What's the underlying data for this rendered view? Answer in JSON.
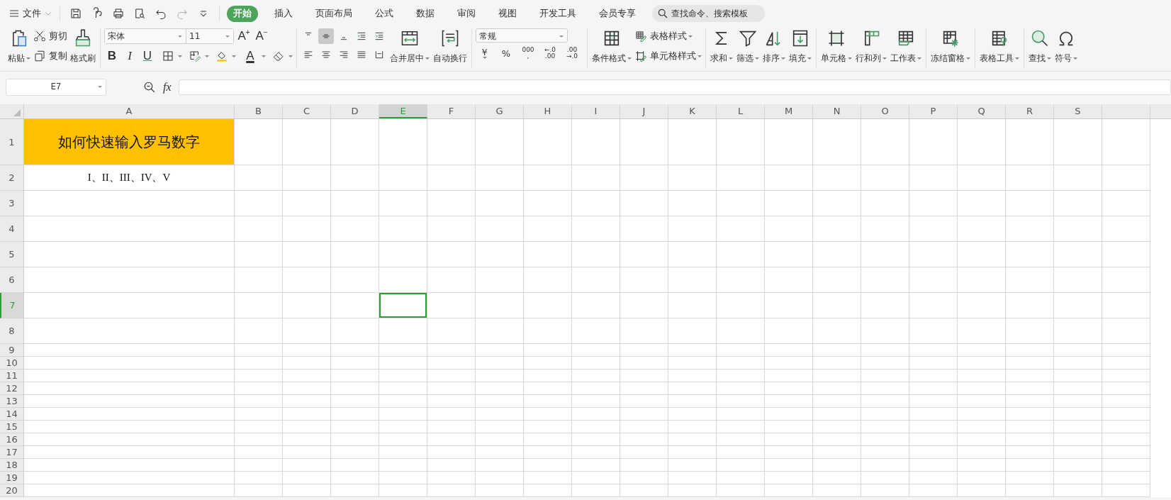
{
  "menu": {
    "label": "文件"
  },
  "quick_access": [
    {
      "disabled": false
    },
    {
      "disabled": false
    },
    {
      "disabled": false
    },
    {
      "disabled": false
    },
    {
      "disabled": false
    },
    {
      "disabled": true
    },
    {
      "disabled": false
    }
  ],
  "tabs": [
    {
      "label": "开始",
      "selected": true
    },
    {
      "label": "插入",
      "selected": false
    },
    {
      "label": "页面布局",
      "selected": false
    },
    {
      "label": "公式",
      "selected": false
    },
    {
      "label": "数据",
      "selected": false
    },
    {
      "label": "审阅",
      "selected": false
    },
    {
      "label": "视图",
      "selected": false
    },
    {
      "label": "开发工具",
      "selected": false
    },
    {
      "label": "会员专享",
      "selected": false
    }
  ],
  "search": {
    "placeholder": "查找命令、搜索模板"
  },
  "clipboard": {
    "paste": {
      "label": "粘贴",
      "dropdown": true
    },
    "small": [
      {
        "label": "剪切",
        "dropdown": false
      },
      {
        "label": "复制",
        "dropdown": false
      }
    ],
    "painter": {
      "label": "格式刷",
      "dropdown": false
    }
  },
  "font": {
    "name": "宋体",
    "size": "11",
    "grow": "A$^{+}$",
    "shrink": "A$^{−}$",
    "styles": [
      {
        "label": "B"
      },
      {
        "label": "I"
      },
      {
        "label": "U"
      }
    ],
    "color_letter": "A"
  },
  "alignment": {
    "buttons": [
      {
        "selected": false
      },
      {
        "selected": true
      },
      {
        "selected": false
      },
      {
        "selected": false
      },
      {
        "selected": false
      },
      {
        "selected": false
      },
      {
        "selected": false
      },
      {
        "selected": false
      },
      {
        "selected": false
      },
      {
        "selected": false
      }
    ],
    "large": [
      {
        "label": "合并居中",
        "dropdown": true
      },
      {
        "label": "自动换行",
        "dropdown": false
      }
    ]
  },
  "number": {
    "format": "常规",
    "buttons": [
      {
        "lines": [
          "￥"
        ],
        "dropdown": true
      },
      {
        "lines": [
          "%"
        ],
        "dropdown": false
      },
      {
        "lines": [
          "000",
          ","
        ],
        "dropdown": false
      },
      {
        "lines": [
          "←.0",
          ".00"
        ],
        "dropdown": false
      },
      {
        "lines": [
          ".00",
          "→.0"
        ],
        "dropdown": false
      }
    ]
  },
  "groups": [
    {
      "large": [
        {
          "label": "条件格式",
          "dropdown": true
        }
      ],
      "small": [
        {
          "label": "表格样式",
          "dropdown": true
        },
        {
          "label": "单元格样式",
          "dropdown": true
        }
      ]
    },
    {
      "large": [
        {
          "label": "求和",
          "dropdown": true
        },
        {
          "label": "筛选",
          "dropdown": true
        },
        {
          "label": "排序",
          "dropdown": true
        },
        {
          "label": "填充",
          "dropdown": true
        }
      ]
    },
    {
      "large": [
        {
          "label": "单元格",
          "dropdown": true
        },
        {
          "label": "行和列",
          "dropdown": true
        },
        {
          "label": "工作表",
          "dropdown": true
        }
      ]
    },
    {
      "large": [
        {
          "label": "冻结窗格",
          "dropdown": true
        }
      ]
    },
    {
      "large": [
        {
          "label": "表格工具",
          "dropdown": true
        }
      ]
    },
    {
      "large": [
        {
          "label": "查找",
          "dropdown": true
        },
        {
          "label": "符号",
          "dropdown": true
        }
      ]
    }
  ],
  "formula_bar": {
    "name_box": "E7",
    "fx": "fx"
  },
  "sheet": {
    "columns": [
      {
        "label": "A",
        "selected": false
      },
      {
        "label": "B",
        "selected": false
      },
      {
        "label": "C",
        "selected": false
      },
      {
        "label": "D",
        "selected": false
      },
      {
        "label": "E",
        "selected": true
      },
      {
        "label": "F",
        "selected": false
      },
      {
        "label": "G",
        "selected": false
      },
      {
        "label": "H",
        "selected": false
      },
      {
        "label": "I",
        "selected": false
      },
      {
        "label": "J",
        "selected": false
      },
      {
        "label": "K",
        "selected": false
      },
      {
        "label": "L",
        "selected": false
      },
      {
        "label": "M",
        "selected": false
      },
      {
        "label": "N",
        "selected": false
      },
      {
        "label": "O",
        "selected": false
      },
      {
        "label": "P",
        "selected": false
      },
      {
        "label": "Q",
        "selected": false
      },
      {
        "label": "R",
        "selected": false
      },
      {
        "label": "S",
        "selected": false
      }
    ],
    "rows": [
      {
        "label": "1",
        "selected": false,
        "cells": [
          {
            "text": "如何快速输入罗马数字",
            "color": "#ffc000"
          }
        ]
      },
      {
        "label": "2",
        "selected": false,
        "cells": [
          {
            "text": "I、II、III、IV、V"
          }
        ]
      },
      {
        "label": "3",
        "selected": false
      },
      {
        "label": "4",
        "selected": false
      },
      {
        "label": "5",
        "selected": false
      },
      {
        "label": "6",
        "selected": false
      },
      {
        "label": "7",
        "selected": true
      },
      {
        "label": "8",
        "selected": false
      },
      {
        "label": "9",
        "selected": false
      },
      {
        "label": "10",
        "selected": false
      },
      {
        "label": "11",
        "selected": false
      },
      {
        "label": "12",
        "selected": false
      },
      {
        "label": "13",
        "selected": false
      },
      {
        "label": "14",
        "selected": false
      },
      {
        "label": "15",
        "selected": false
      },
      {
        "label": "16",
        "selected": false
      },
      {
        "label": "17",
        "selected": false
      },
      {
        "label": "18",
        "selected": false
      },
      {
        "label": "19",
        "selected": false
      },
      {
        "label": "20",
        "selected": false
      }
    ]
  }
}
